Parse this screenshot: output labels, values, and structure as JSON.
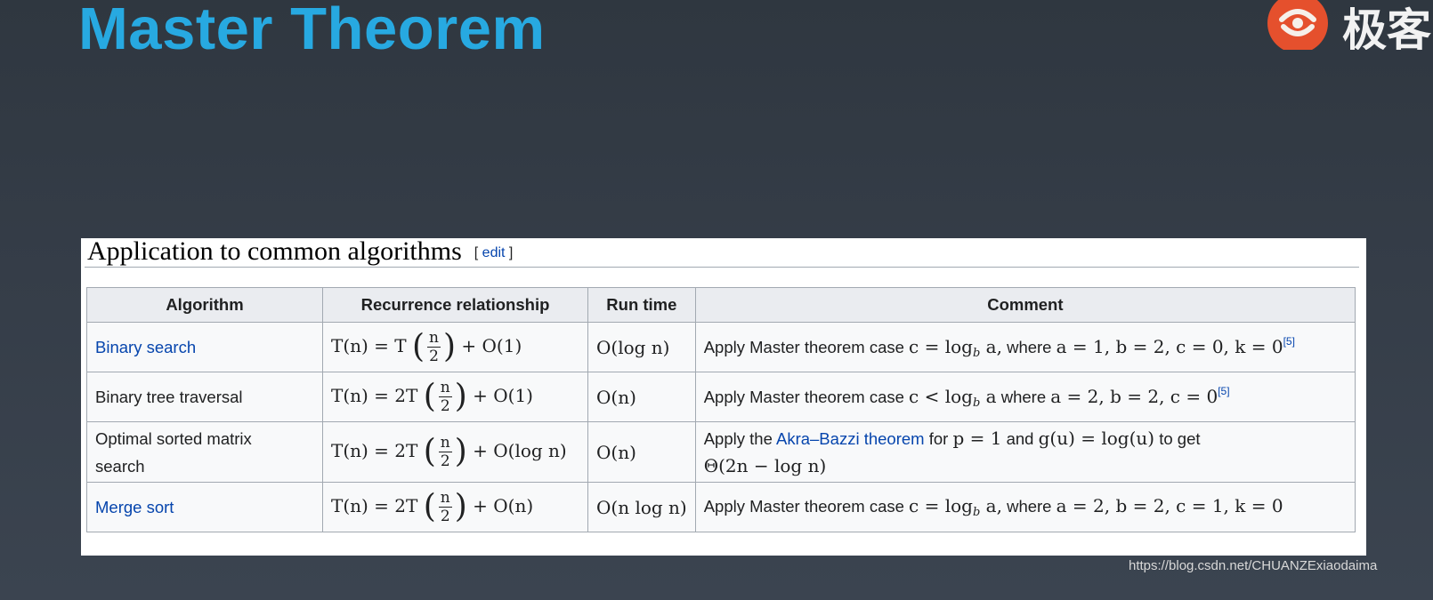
{
  "slide": {
    "title": "Master Theorem"
  },
  "logo": {
    "text": "极客"
  },
  "section": {
    "heading": "Application to common algorithms",
    "edit_prefix": "[ ",
    "edit_label": "edit",
    "edit_suffix": " ]"
  },
  "table": {
    "headers": [
      "Algorithm",
      "Recurrence relationship",
      "Run time",
      "Comment"
    ],
    "rows": [
      {
        "algorithm": "Binary search",
        "recurrence": {
          "lhs": "T(n) = T",
          "num": "n",
          "den": "2",
          "rhs": "+ O(1)"
        },
        "runtime": "O(log n)",
        "comment": {
          "text_before": "Apply Master theorem case",
          "math_1": "c = log",
          "sub": "b",
          "math_2": " a,",
          "text_after": "where",
          "math_3": "a = 1, b = 2, c = 0, k = 0",
          "ref": "[5]"
        }
      },
      {
        "algorithm": "Binary tree traversal",
        "recurrence": {
          "lhs": "T(n) = 2T",
          "num": "n",
          "den": "2",
          "rhs": "+ O(1)"
        },
        "runtime": "O(n)",
        "comment": {
          "text_before": "Apply Master theorem case",
          "math_1": "c < log",
          "sub": "b",
          "math_2": " a",
          "text_after": "where",
          "math_3": "a = 2, b = 2, c = 0",
          "ref": "[5]"
        }
      },
      {
        "algorithm": "Optimal sorted matrix search",
        "recurrence": {
          "lhs": "T(n) = 2T",
          "num": "n",
          "den": "2",
          "rhs": "+ O(log n)"
        },
        "runtime": "O(n)",
        "comment": {
          "text_1": "Apply the",
          "link": "Akra–Bazzi theorem",
          "text_2": "for",
          "math_1": "p = 1",
          "text_3": "and",
          "math_2": "g(u) = log(u)",
          "text_4": "to get",
          "math_3": "Θ(2n − log n)"
        }
      },
      {
        "algorithm": "Merge sort",
        "recurrence": {
          "lhs": "T(n) = 2T",
          "num": "n",
          "den": "2",
          "rhs": "+ O(n)"
        },
        "runtime": "O(n log n)",
        "comment": {
          "text_before": "Apply Master theorem case",
          "math_1": "c = log",
          "sub": "b",
          "math_2": " a,",
          "text_after": "where",
          "math_3": "a = 2, b = 2, c = 1, k = 0"
        }
      }
    ]
  },
  "watermark": "https://blog.csdn.net/CHUANZExiaodaima",
  "colors": {
    "title": "#27a9e1",
    "link": "#0645ad",
    "logo_red": "#e5502d",
    "background": "#343c47"
  }
}
